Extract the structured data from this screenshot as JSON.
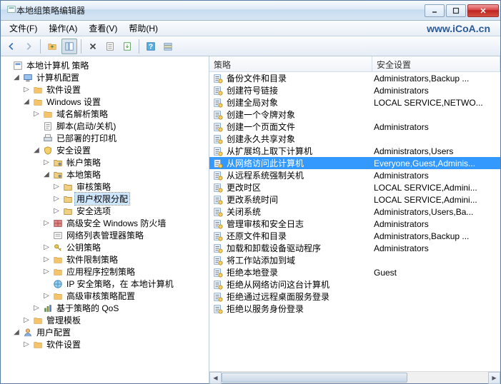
{
  "window": {
    "title": "本地组策略编辑器"
  },
  "menu": {
    "file": "文件(F)",
    "action": "操作(A)",
    "view": "查看(V)",
    "help": "帮助(H)",
    "watermark": "www.iCoA.cn"
  },
  "columns": {
    "policy": "策略",
    "setting": "安全设置"
  },
  "tree": {
    "root": "本地计算机 策略",
    "computer_config": "计算机配置",
    "software_settings": "软件设置",
    "windows_settings": "Windows 设置",
    "name_resolution": "域名解析策略",
    "scripts": "脚本(启动/关机)",
    "deployed_printers": "已部署的打印机",
    "security_settings": "安全设置",
    "account_policies": "帐户策略",
    "local_policies": "本地策略",
    "audit_policy": "审核策略",
    "user_rights": "用户权限分配",
    "security_options": "安全选项",
    "firewall": "高级安全 Windows 防火墙",
    "network_list": "网络列表管理器策略",
    "public_key": "公钥策略",
    "software_restriction": "软件限制策略",
    "app_control": "应用程序控制策略",
    "ip_security": "IP 安全策略，在 本地计算机",
    "advanced_audit": "高级审核策略配置",
    "policy_qos": "基于策略的 QoS",
    "admin_templates": "管理模板",
    "user_config": "用户配置",
    "user_software": "软件设置"
  },
  "rows": [
    {
      "policy": "备份文件和目录",
      "setting": "Administrators,Backup ..."
    },
    {
      "policy": "创建符号链接",
      "setting": "Administrators"
    },
    {
      "policy": "创建全局对象",
      "setting": "LOCAL SERVICE,NETWO..."
    },
    {
      "policy": "创建一个令牌对象",
      "setting": ""
    },
    {
      "policy": "创建一个页面文件",
      "setting": "Administrators"
    },
    {
      "policy": "创建永久共享对象",
      "setting": ""
    },
    {
      "policy": "从扩展坞上取下计算机",
      "setting": "Administrators,Users"
    },
    {
      "policy": "从网络访问此计算机",
      "setting": "Everyone,Guest,Adminis..."
    },
    {
      "policy": "从远程系统强制关机",
      "setting": "Administrators"
    },
    {
      "policy": "更改时区",
      "setting": "LOCAL SERVICE,Admini..."
    },
    {
      "policy": "更改系统时间",
      "setting": "LOCAL SERVICE,Admini..."
    },
    {
      "policy": "关闭系统",
      "setting": "Administrators,Users,Ba..."
    },
    {
      "policy": "管理审核和安全日志",
      "setting": "Administrators"
    },
    {
      "policy": "还原文件和目录",
      "setting": "Administrators,Backup ..."
    },
    {
      "policy": "加载和卸载设备驱动程序",
      "setting": "Administrators"
    },
    {
      "policy": "将工作站添加到域",
      "setting": ""
    },
    {
      "policy": "拒绝本地登录",
      "setting": "Guest"
    },
    {
      "policy": "拒绝从网络访问这台计算机",
      "setting": ""
    },
    {
      "policy": "拒绝通过远程桌面服务登录",
      "setting": ""
    },
    {
      "policy": "拒绝以服务身份登录",
      "setting": ""
    }
  ],
  "selected_row": 7
}
